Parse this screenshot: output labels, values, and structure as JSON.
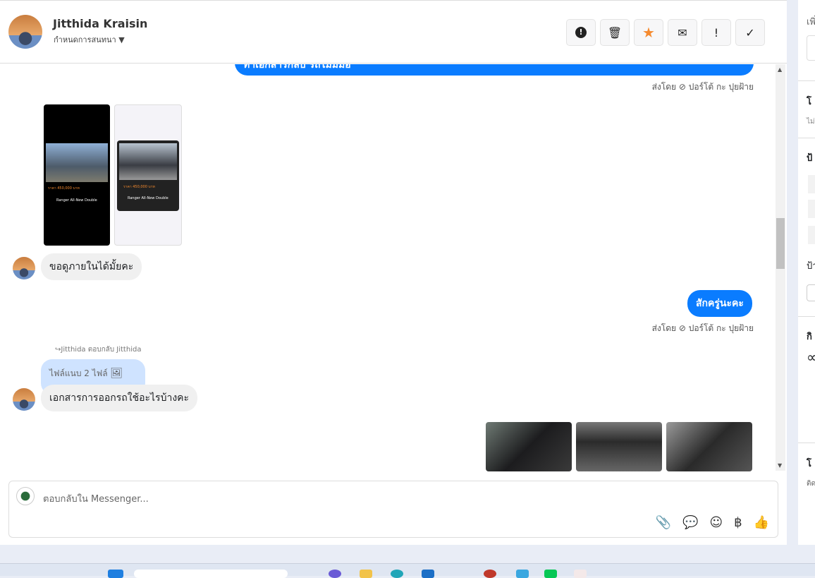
{
  "header": {
    "name": "Jitthida Kraisin",
    "subtitle": "กำหนดการสนทนา"
  },
  "toolbar": [
    {
      "icon": "alert-circle-icon",
      "glyph": "❗"
    },
    {
      "icon": "trash-icon",
      "glyph": "🗑"
    },
    {
      "icon": "star-icon",
      "glyph": "★"
    },
    {
      "icon": "envelope-icon",
      "glyph": "✉"
    },
    {
      "icon": "exclamation-icon",
      "glyph": "!"
    },
    {
      "icon": "check-icon",
      "glyph": "✓"
    }
  ],
  "messages": {
    "top_partial": "ทำเอกสารกลับ รถไม่มีมือ",
    "sent_by_1": "ส่งโดย ⊘ ปอร์โต้ กะ ปุยฝ้าย",
    "in_1": "ขอดูภายในได้มั้ยคะ",
    "out_1": "สักครู่นะคะ",
    "sent_by_2": "ส่งโดย ⊘ ปอร์โต้ กะ ปุยฝ้าย",
    "reply_note": "Jitthida ตอบกลับ Jitthida",
    "attachment": "ไฟล์แนบ 2 ไฟล์",
    "in_2": "เอกสารการออกรถใช้อะไรบ้างคะ",
    "screenshot_text": "ราคา 450,000 บาท",
    "screenshot_model": "Ranger All-New Double"
  },
  "composer": {
    "placeholder": "ตอบกลับใน Messenger...",
    "currency": "฿"
  },
  "right_panel": {
    "s1": "เพิ่",
    "s2": "โ",
    "s2sub": "ไม่",
    "s3": "ป้",
    "s3b": "ป้า",
    "s4": "กิ",
    "s4sub": "∝",
    "s5": "โ",
    "s5sub": "ติด"
  }
}
